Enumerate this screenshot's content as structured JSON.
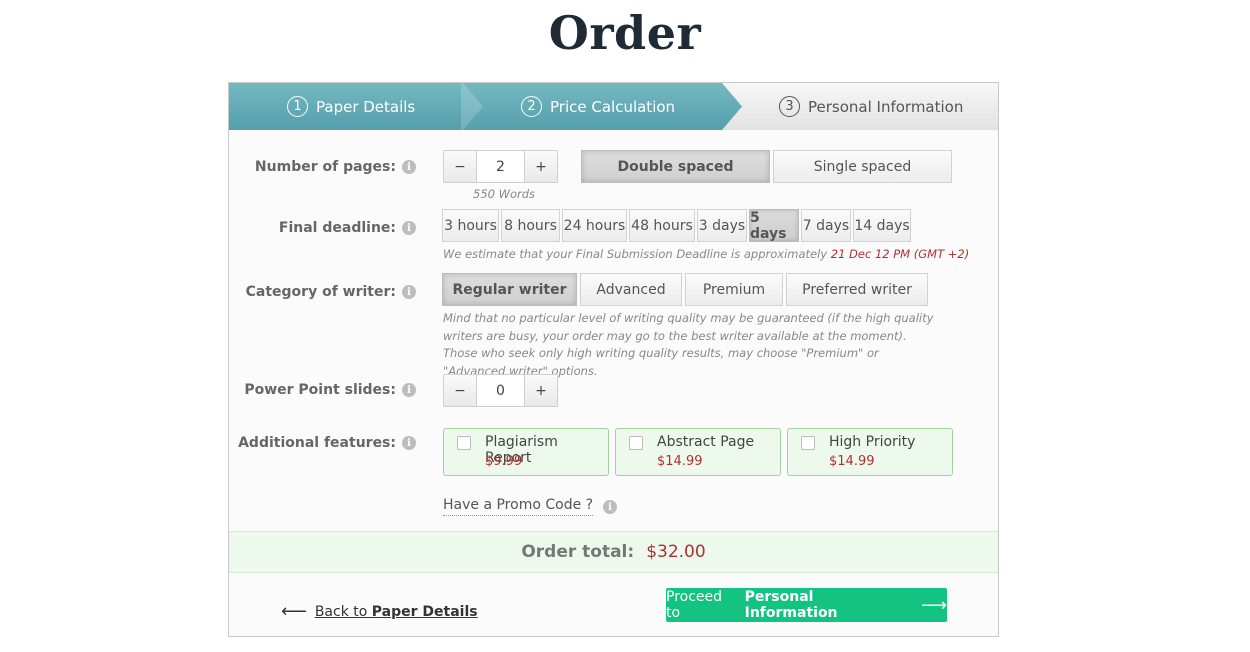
{
  "page_title": "Order",
  "steps": [
    {
      "num": "1",
      "label": "Paper Details"
    },
    {
      "num": "2",
      "label": "Price Calculation"
    },
    {
      "num": "3",
      "label": "Personal Information"
    }
  ],
  "pages": {
    "label": "Number of pages:",
    "minus": "−",
    "plus": "+",
    "value": "2",
    "words": "550 Words"
  },
  "spacing": {
    "options": [
      "Double spaced",
      "Single spaced"
    ],
    "selected": "Double spaced"
  },
  "deadline": {
    "label": "Final deadline:",
    "options": [
      "3 hours",
      "8 hours",
      "24 hours",
      "48 hours",
      "3 days",
      "5 days",
      "7 days",
      "14 days"
    ],
    "selected": "5 days",
    "note_prefix": "We estimate that your Final Submission Deadline is approximately ",
    "note_date": "21 Dec 12 PM (GMT +2)"
  },
  "writer": {
    "label": "Category of writer:",
    "options": [
      "Regular writer",
      "Advanced",
      "Premium",
      "Preferred writer"
    ],
    "selected": "Regular writer",
    "note": "Mind that no particular level of writing quality may be guaranteed (if the high quality writers are busy, your order may go to the best writer available at the moment). Those who seek only high writing quality results, may choose \"Premium\" or \"Advanced writer\" options."
  },
  "slides": {
    "label": "Power Point slides:",
    "minus": "−",
    "plus": "+",
    "value": "0"
  },
  "features": {
    "label": "Additional features:",
    "items": [
      {
        "name": "Plagiarism Report",
        "price": "$9.99",
        "checked": false
      },
      {
        "name": "Abstract Page",
        "price": "$14.99",
        "checked": false
      },
      {
        "name": "High Priority",
        "price": "$14.99",
        "checked": false
      }
    ]
  },
  "promo": {
    "label": "Have a Promo Code ?"
  },
  "total": {
    "label": "Order total:",
    "amount": "$32.00"
  },
  "back": {
    "prefix": "Back to",
    "target": "Paper Details"
  },
  "proceed": {
    "prefix": "Proceed to",
    "target": "Personal Information"
  },
  "colors": {
    "accent_teal": "#5ea6b1",
    "proceed_green": "#13c381",
    "price_red": "#b03030",
    "feature_bg": "#eef9ee"
  },
  "icons": {
    "info": "info-icon",
    "back_arrow": "arrow-left-icon",
    "next_arrow": "arrow-right-icon"
  }
}
